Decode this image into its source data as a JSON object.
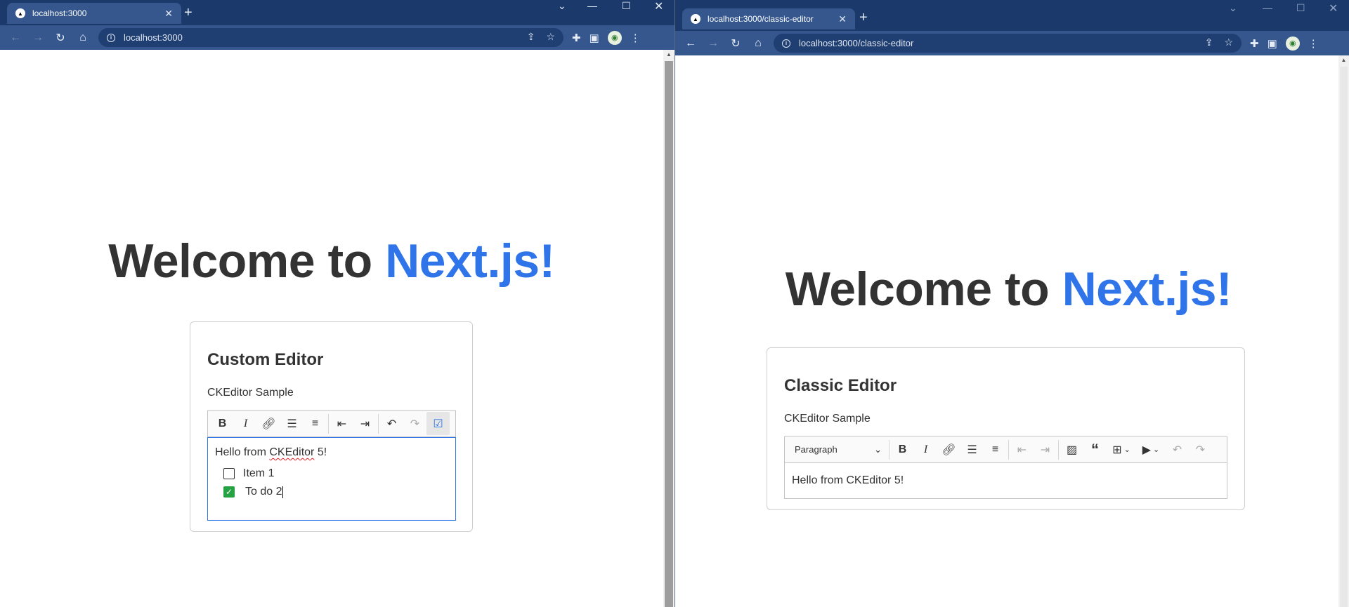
{
  "left_window": {
    "tab": {
      "title": "localhost:3000"
    },
    "url": "localhost:3000",
    "hero": {
      "text": "Welcome to ",
      "accent": "Next.js!"
    },
    "card": {
      "title": "Custom Editor",
      "subtitle": "CKEditor Sample",
      "toolbar": [
        "bold-icon",
        "italic-icon",
        "link-icon",
        "bulleted-list-icon",
        "numbered-list-icon",
        "outdent-icon",
        "indent-icon",
        "undo-icon",
        "redo-icon",
        "todo-list-icon"
      ],
      "content": {
        "para_before": "Hello from ",
        "para_misspelled": "CKEditor",
        "para_after": " 5!",
        "todos": [
          {
            "label": "Item 1",
            "checked": false
          },
          {
            "label": "To do 2",
            "checked": true
          }
        ]
      }
    }
  },
  "right_window": {
    "tab": {
      "title": "localhost:3000/classic-editor"
    },
    "url": "localhost:3000/classic-editor",
    "hero": {
      "text": "Welcome to ",
      "accent": "Next.js!"
    },
    "card": {
      "title": "Classic Editor",
      "subtitle": "CKEditor Sample",
      "heading_dropdown": "Paragraph",
      "toolbar": [
        "heading-dropdown",
        "bold-icon",
        "italic-icon",
        "link-icon",
        "bulleted-list-icon",
        "numbered-list-icon",
        "outdent-icon",
        "indent-icon",
        "image-icon",
        "blockquote-icon",
        "table-icon",
        "media-icon",
        "undo-icon",
        "redo-icon"
      ],
      "content": {
        "para": "Hello from CKEditor 5!"
      }
    }
  },
  "colors": {
    "accent": "#2f74e8",
    "chrome_dark": "#1b3a6b",
    "chrome": "#35578e",
    "todo_checked": "#25a244"
  }
}
